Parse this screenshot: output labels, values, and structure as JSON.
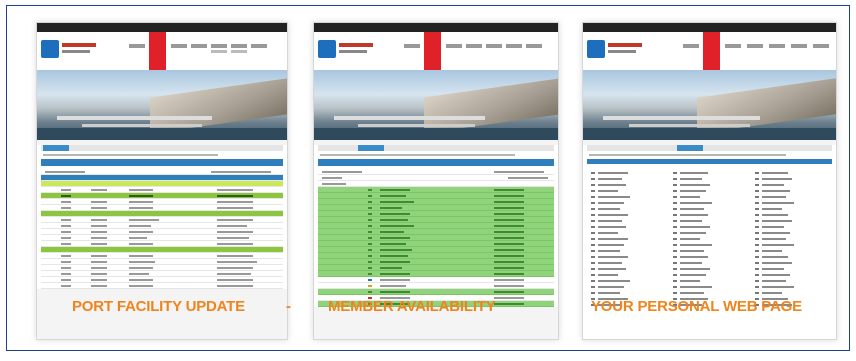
{
  "captions": {
    "port_facility": "PORT FACILITY UPDATE",
    "separator": "-",
    "member_availability": "MEMBER AVAILABILITY",
    "personal_web_page": "YOUR PERSONAL WEB PAGE"
  },
  "colors": {
    "caption": "#f0841c",
    "frame_border": "#1f3f8f",
    "nav_active": "#e1212a",
    "table_header": "#2e7fbc",
    "availability_green": "#8fd47a"
  }
}
